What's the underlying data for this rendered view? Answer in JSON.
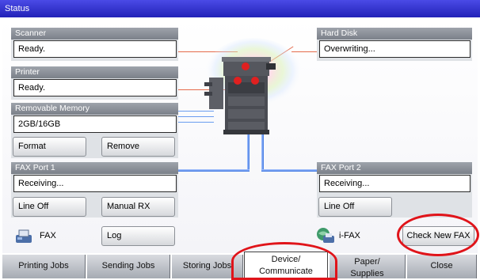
{
  "title": "Status",
  "scanner": {
    "label": "Scanner",
    "status": "Ready."
  },
  "printer": {
    "label": "Printer",
    "status": "Ready."
  },
  "memory": {
    "label": "Removable Memory",
    "value": "2GB/16GB",
    "format_label": "Format",
    "remove_label": "Remove"
  },
  "hard_disk": {
    "label": "Hard Disk",
    "status": "Overwriting..."
  },
  "fax_port1": {
    "label": "FAX Port 1",
    "status": "Receiving...",
    "line_off_label": "Line Off",
    "manual_rx_label": "Manual RX"
  },
  "fax_port2": {
    "label": "FAX Port 2",
    "status": "Receiving...",
    "line_off_label": "Line Off"
  },
  "fax": {
    "label": "FAX",
    "log_label": "Log"
  },
  "ifax": {
    "label": "i-FAX",
    "check_label": "Check New FAX"
  },
  "tabs": [
    {
      "label": "Printing Jobs",
      "active": false
    },
    {
      "label": "Sending Jobs",
      "active": false
    },
    {
      "label": "Storing Jobs",
      "active": false
    },
    {
      "label": "Device/ Communicate",
      "line1": "Device/",
      "line2": "Communicate",
      "active": true
    },
    {
      "label": "Paper/ Supplies",
      "line1": "Paper/",
      "line2": "Supplies",
      "active": false
    },
    {
      "label": "Close",
      "active": false
    }
  ],
  "highlights": [
    "Check New FAX",
    "Device/ Communicate"
  ],
  "colors": {
    "title_bar": "#2a2ac8",
    "label_bar": "#8a8f97",
    "connector_red": "#e56b4b",
    "connector_blue": "#5b8fe6",
    "highlight": "#e0141a"
  }
}
